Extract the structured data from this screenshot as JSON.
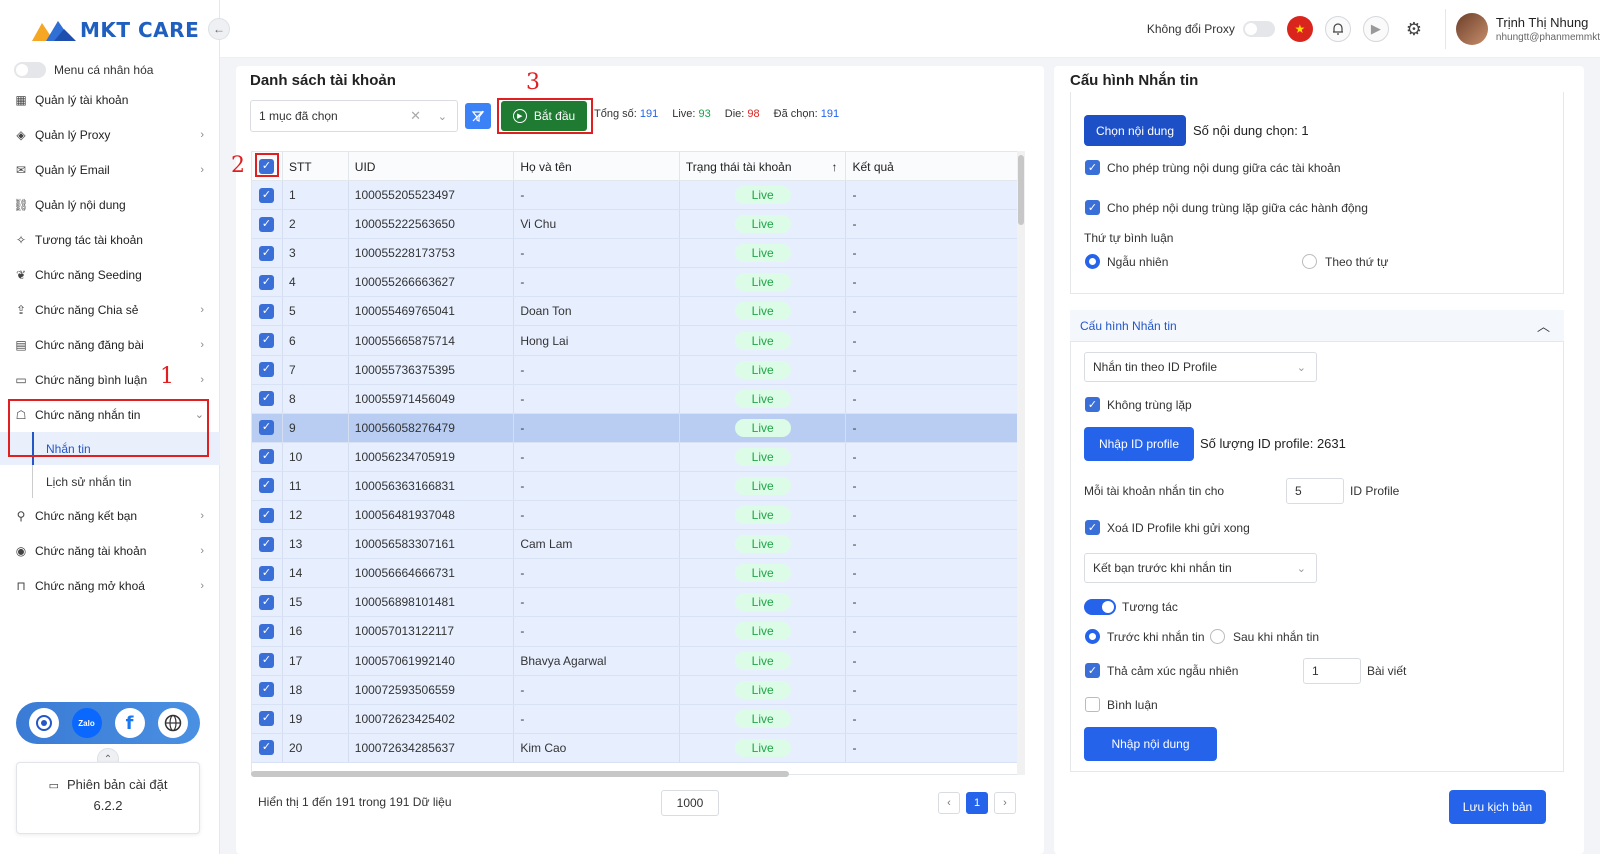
{
  "brand": {
    "name": "MKT CARE"
  },
  "sidebar": {
    "personalize_label": "Menu cá nhân hóa",
    "items": [
      {
        "label": "Quản lý tài khoản",
        "icon": "grid-icon",
        "chev": false
      },
      {
        "label": "Quản lý Proxy",
        "icon": "layers-icon",
        "chev": true
      },
      {
        "label": "Quản lý Email",
        "icon": "mail-icon",
        "chev": true
      },
      {
        "label": "Quản lý nội dung",
        "icon": "link-icon",
        "chev": false
      },
      {
        "label": "Tương tác tài khoản",
        "icon": "sparkle-icon",
        "chev": false
      },
      {
        "label": "Chức năng Seeding",
        "icon": "seeding-icon",
        "chev": false
      },
      {
        "label": "Chức năng Chia sẻ",
        "icon": "share-icon",
        "chev": true
      },
      {
        "label": "Chức năng đăng bài",
        "icon": "post-icon",
        "chev": true
      },
      {
        "label": "Chức năng bình luận",
        "icon": "comment-icon",
        "chev": true
      },
      {
        "label": "Chức năng nhắn tin",
        "icon": "chat-icon",
        "chev": true,
        "open": true
      }
    ],
    "subitems": [
      {
        "label": "Nhắn tin",
        "active": true
      },
      {
        "label": "Lịch sử nhắn tin",
        "active": false
      }
    ],
    "items_after": [
      {
        "label": "Chức năng kết bạn",
        "icon": "add-user-icon",
        "chev": true
      },
      {
        "label": "Chức năng tài khoản",
        "icon": "user-circle-icon",
        "chev": true
      },
      {
        "label": "Chức năng mở khoá",
        "icon": "lock-icon",
        "chev": true
      }
    ],
    "version_label": "Phiên bản cài đặt",
    "version_value": "6.2.2"
  },
  "header": {
    "proxy_label": "Không đổi Proxy",
    "user_name": "Trịnh Thị Nhung",
    "user_email": "nhungtt@phanmemmkt"
  },
  "annotations": {
    "a1": "1",
    "a2": "2",
    "a3": "3"
  },
  "accounts": {
    "title": "Danh sách tài khoản",
    "selected_text": "1 mục đã chọn",
    "start_label": "Bắt đầu",
    "stats": {
      "total_label": "Tổng số:",
      "total": "191",
      "live_label": "Live:",
      "live": "93",
      "die_label": "Die:",
      "die": "98",
      "chosen_label": "Đã chọn:",
      "chosen": "191"
    },
    "columns": [
      "STT",
      "UID",
      "Họ và tên",
      "Trạng thái tài khoản",
      "Kết quả"
    ],
    "rows": [
      {
        "stt": "1",
        "uid": "100055205523497",
        "name": "-",
        "status": "Live",
        "result": "-"
      },
      {
        "stt": "2",
        "uid": "100055222563650",
        "name": "Vi Chu",
        "status": "Live",
        "result": "-"
      },
      {
        "stt": "3",
        "uid": "100055228173753",
        "name": "-",
        "status": "Live",
        "result": "-"
      },
      {
        "stt": "4",
        "uid": "100055266663627",
        "name": "-",
        "status": "Live",
        "result": "-"
      },
      {
        "stt": "5",
        "uid": "100055469765041",
        "name": "Doan Ton",
        "status": "Live",
        "result": "-"
      },
      {
        "stt": "6",
        "uid": "100055665875714",
        "name": "Hong Lai",
        "status": "Live",
        "result": "-"
      },
      {
        "stt": "7",
        "uid": "100055736375395",
        "name": "-",
        "status": "Live",
        "result": "-"
      },
      {
        "stt": "8",
        "uid": "100055971456049",
        "name": "-",
        "status": "Live",
        "result": "-"
      },
      {
        "stt": "9",
        "uid": "100056058276479",
        "name": "-",
        "status": "Live",
        "result": "-",
        "hl": true
      },
      {
        "stt": "10",
        "uid": "100056234705919",
        "name": "-",
        "status": "Live",
        "result": "-"
      },
      {
        "stt": "11",
        "uid": "100056363166831",
        "name": "-",
        "status": "Live",
        "result": "-"
      },
      {
        "stt": "12",
        "uid": "100056481937048",
        "name": "-",
        "status": "Live",
        "result": "-"
      },
      {
        "stt": "13",
        "uid": "100056583307161",
        "name": "Cam Lam",
        "status": "Live",
        "result": "-"
      },
      {
        "stt": "14",
        "uid": "100056664666731",
        "name": "-",
        "status": "Live",
        "result": "-"
      },
      {
        "stt": "15",
        "uid": "100056898101481",
        "name": "-",
        "status": "Live",
        "result": "-"
      },
      {
        "stt": "16",
        "uid": "100057013122117",
        "name": "-",
        "status": "Live",
        "result": "-"
      },
      {
        "stt": "17",
        "uid": "100057061992140",
        "name": "Bhavya Agarwal",
        "status": "Live",
        "result": "-"
      },
      {
        "stt": "18",
        "uid": "100072593506559",
        "name": "-",
        "status": "Live",
        "result": "-"
      },
      {
        "stt": "19",
        "uid": "100072623425402",
        "name": "-",
        "status": "Live",
        "result": "-"
      },
      {
        "stt": "20",
        "uid": "100072634285637",
        "name": "Kim Cao",
        "status": "Live",
        "result": "-"
      }
    ],
    "footer_text": "Hiển thị 1 đến 191 trong 191 Dữ liệu",
    "page_size": "1000",
    "page_current": "1",
    "prev": "‹",
    "next": "›"
  },
  "config": {
    "title": "Cấu hình Nhắn tin",
    "choose_content_label": "Chọn nội dung",
    "content_count": "Số nội dung chọn: 1",
    "allow_dup_accounts": "Cho phép trùng nội dung giữa các tài khoản",
    "allow_dup_actions": "Cho phép nội dung trùng lặp giữa các hành động",
    "comment_order_label": "Thứ tự bình luận",
    "order_random": "Ngẫu nhiên",
    "order_seq": "Theo thứ tự",
    "section_title": "Cấu hình Nhắn tin",
    "mode_select": "Nhắn tin theo ID Profile",
    "no_dup": "Không trùng lặp",
    "import_id_label": "Nhập ID profile",
    "id_count": "Số lượng ID profile: 2631",
    "per_account_label": "Mỗi tài khoản nhắn tin cho",
    "per_account_value": "5",
    "per_account_unit": "ID Profile",
    "delete_after": "Xoá ID Profile khi gửi xong",
    "friend_select": "Kết bạn trước khi nhắn tin",
    "interact_label": "Tương tác",
    "before_msg": "Trước khi nhắn tin",
    "after_msg": "Sau khi nhắn tin",
    "react_label": "Thả cảm xúc ngẫu nhiên",
    "react_value": "1",
    "react_unit": "Bài viết",
    "comment_label": "Bình luận",
    "import_content_label": "Nhập nội dung",
    "save_label": "Lưu kịch bản"
  }
}
